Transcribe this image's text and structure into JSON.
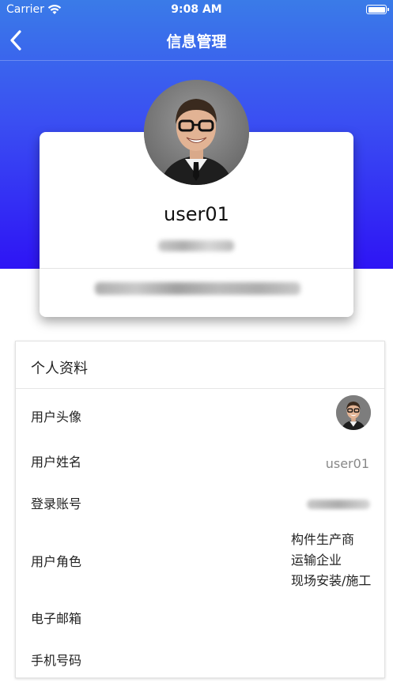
{
  "status_bar": {
    "carrier": "Carrier",
    "time": "9:08 AM"
  },
  "nav": {
    "title": "信息管理"
  },
  "profile_card": {
    "username": "user01"
  },
  "details": {
    "section_title": "个人资料",
    "rows": {
      "avatar_label": "用户头像",
      "name_label": "用户姓名",
      "name_value": "user01",
      "account_label": "登录账号",
      "role_label": "用户角色",
      "roles": [
        "构件生产商",
        "运输企业",
        "现场安装/施工"
      ],
      "email_label": "电子邮箱",
      "phone_label": "手机号码"
    }
  },
  "colors": {
    "header_gradient_top": "#3a7be8",
    "header_gradient_bottom": "#2e14f5",
    "text_primary": "#222222",
    "text_secondary": "#888888"
  },
  "icons": [
    "wifi-icon",
    "battery-icon",
    "back-chevron-icon",
    "avatar-photo"
  ]
}
